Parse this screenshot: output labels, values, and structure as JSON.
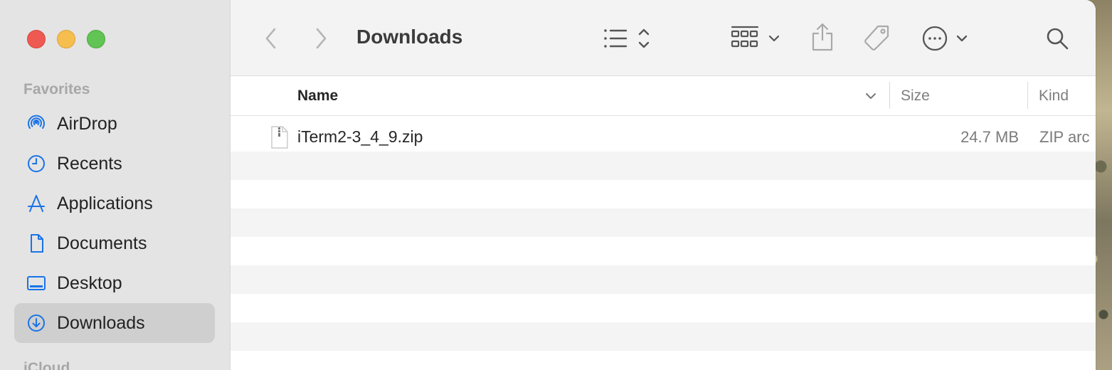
{
  "window": {
    "title": "Downloads"
  },
  "sidebar": {
    "favorites_title": "Favorites",
    "next_section_title": "iCloud",
    "items": [
      {
        "label": "AirDrop",
        "icon": "airdrop-icon"
      },
      {
        "label": "Recents",
        "icon": "clock-icon"
      },
      {
        "label": "Applications",
        "icon": "applications-icon"
      },
      {
        "label": "Documents",
        "icon": "document-icon"
      },
      {
        "label": "Desktop",
        "icon": "desktop-icon"
      },
      {
        "label": "Downloads",
        "icon": "download-icon",
        "selected": true
      }
    ]
  },
  "columns": {
    "name": "Name",
    "size": "Size",
    "kind": "Kind"
  },
  "files": [
    {
      "name": "iTerm2-3_4_9.zip",
      "size": "24.7 MB",
      "kind": "ZIP arc",
      "icon": "zip-file-icon"
    }
  ],
  "colors": {
    "accent": "#1a73e8",
    "sidebar_bg": "#e4e4e4",
    "selected_bg": "#cfcfcf"
  }
}
